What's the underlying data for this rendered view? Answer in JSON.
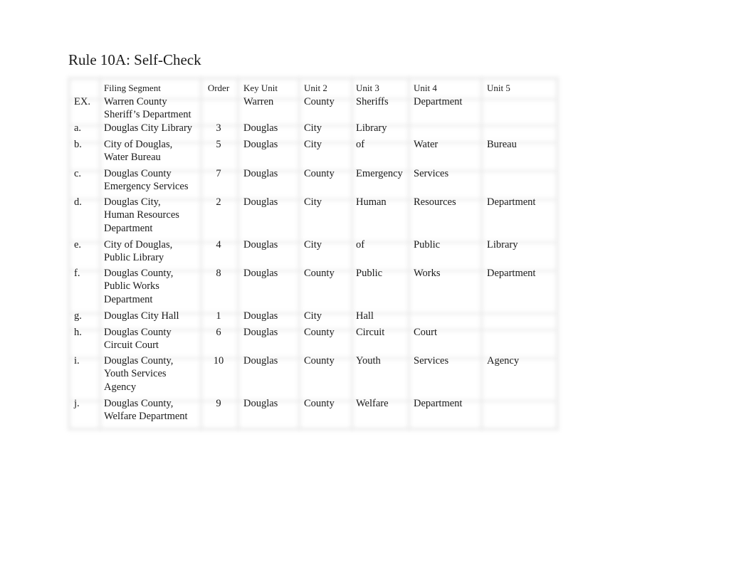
{
  "title": "Rule 10A: Self-Check",
  "table": {
    "headers": {
      "label": "",
      "segment": "Filing Segment",
      "order": "Order",
      "key": "Key Unit",
      "u2": "Unit 2",
      "u3": "Unit 3",
      "u4": "Unit 4",
      "u5": "Unit 5"
    },
    "rows": [
      {
        "label": "EX.",
        "segment": "Warren County\nSheriff’s Department",
        "order": "",
        "key": "Warren",
        "u2": "County",
        "u3": "Sheriffs",
        "u4": "Department",
        "u5": ""
      },
      {
        "label": "a.",
        "segment": "Douglas City Library",
        "order": "3",
        "key": "Douglas",
        "u2": "City",
        "u3": "Library",
        "u4": "",
        "u5": ""
      },
      {
        "label": "b.",
        "segment": "City of Douglas,\nWater Bureau",
        "order": "5",
        "key": "Douglas",
        "u2": "City",
        "u3": "of",
        "u4": "Water",
        "u5": "Bureau"
      },
      {
        "label": "c.",
        "segment": "Douglas County\nEmergency Services",
        "order": "7",
        "key": "Douglas",
        "u2": "County",
        "u3": "Emergency",
        "u4": "Services",
        "u5": ""
      },
      {
        "label": "d.",
        "segment": "Douglas City,\nHuman Resources\nDepartment",
        "order": "2",
        "key": "Douglas",
        "u2": "City",
        "u3": "Human",
        "u4": "Resources",
        "u5": "Department"
      },
      {
        "label": "e.",
        "segment": "City of Douglas,\nPublic Library",
        "order": "4",
        "key": "Douglas",
        "u2": "City",
        "u3": "of",
        "u4": "Public",
        "u5": "Library"
      },
      {
        "label": "f.",
        "segment": "Douglas County,\nPublic Works\nDepartment",
        "order": "8",
        "key": "Douglas",
        "u2": "County",
        "u3": "Public",
        "u4": "Works",
        "u5": "Department"
      },
      {
        "label": "g.",
        "segment": "Douglas City Hall",
        "order": "1",
        "key": "Douglas",
        "u2": "City",
        "u3": "Hall",
        "u4": "",
        "u5": ""
      },
      {
        "label": "h.",
        "segment": "Douglas County\nCircuit Court",
        "order": "6",
        "key": "Douglas",
        "u2": "County",
        "u3": "Circuit",
        "u4": "Court",
        "u5": ""
      },
      {
        "label": "i.",
        "segment": "Douglas County,\nYouth Services\nAgency",
        "order": "10",
        "key": "Douglas",
        "u2": "County",
        "u3": "Youth",
        "u4": "Services",
        "u5": "Agency"
      },
      {
        "label": "j.",
        "segment": "Douglas County,\nWelfare Department",
        "order": "9",
        "key": "Douglas",
        "u2": "County",
        "u3": "Welfare",
        "u4": "Department",
        "u5": ""
      }
    ]
  }
}
